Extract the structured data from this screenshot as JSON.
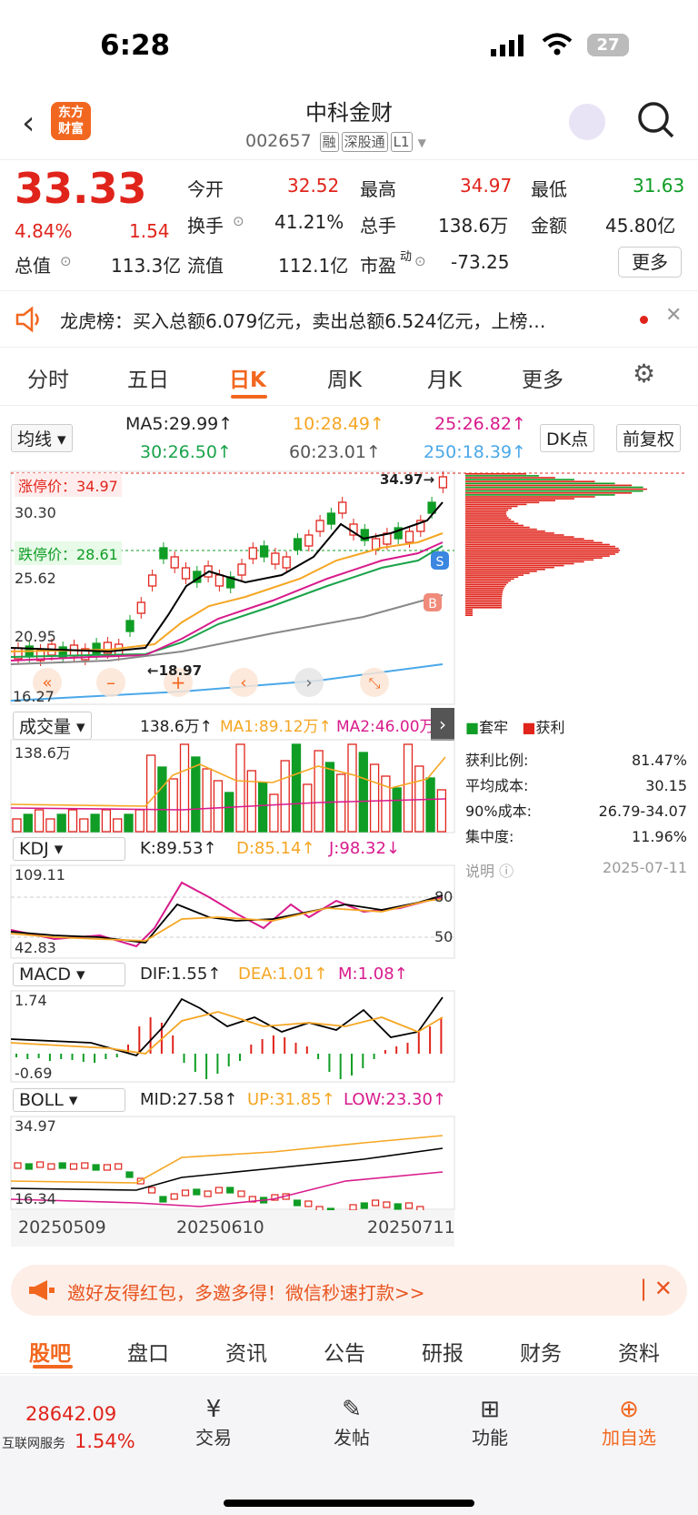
{
  "status": {
    "time": "6:28",
    "battery": "27"
  },
  "header": {
    "title": "中科金财",
    "code": "002657",
    "tags": [
      "融",
      "深股通",
      "L1"
    ],
    "logo": "东方\n财富"
  },
  "quote": {
    "price": "33.33",
    "pct": "4.84%",
    "chg": "1.54",
    "open_label": "今开",
    "open": "32.52",
    "high_label": "最高",
    "high": "34.97",
    "low_label": "最低",
    "low": "31.63",
    "turn_label": "换手",
    "turn": "41.21%",
    "vol_label": "总手",
    "vol": "138.6万",
    "amt_label": "金额",
    "amt": "45.80亿",
    "mcap_label": "总值",
    "mcap": "113.3亿",
    "float_label": "流值",
    "float": "112.1亿",
    "pe_label": "市盈",
    "pe_sup": "动",
    "pe": "-73.25",
    "more": "更多"
  },
  "notice": {
    "text": "龙虎榜：买入总额6.079亿元，卖出总额6.524亿元，上榜…"
  },
  "tabs": [
    "分时",
    "五日",
    "日K",
    "周K",
    "月K",
    "更多",
    "⚙"
  ],
  "ma": {
    "select": "均线",
    "ma5": "MA5:29.99↑",
    "ma10": "10:28.49↑",
    "ma25": "25:26.82↑",
    "ma30": "30:26.50↑",
    "ma60": "60:23.01↑",
    "ma250": "250:18.39↑",
    "dk": "DK点",
    "fq": "前复权"
  },
  "kline": {
    "top": "34.97",
    "p1": "30.30",
    "p2": "25.62",
    "p3": "20.95",
    "bottom": "16.27",
    "limit_up": "涨停价：34.97",
    "limit_down": "跌停价：28.61",
    "hi_mark": "34.97→",
    "lo_mark": "←18.97",
    "S": "S",
    "B": "B"
  },
  "chip": {
    "legend1": "套牢",
    "legend2": "获利",
    "profit_ratio_l": "获利比例:",
    "profit_ratio": "81.47%",
    "avg_cost_l": "平均成本:",
    "avg_cost": "30.15",
    "c90_l": "90%成本:",
    "c90": "26.79-34.07",
    "conc_l": "集中度:",
    "conc": "11.96%",
    "note": "说明",
    "date": "2025-07-11"
  },
  "vol": {
    "select": "成交量",
    "v": "138.6万↑",
    "ma1": "MA1:89.12万↑",
    "ma2": "MA2:46.00万↑",
    "axis": "138.6万"
  },
  "kdj": {
    "select": "KDJ",
    "k": "K:89.53↑",
    "d": "D:85.14↑",
    "j": "J:98.32↓",
    "top": "109.11",
    "bottom": "42.83",
    "l80": "80",
    "l50": "50"
  },
  "macd": {
    "select": "MACD",
    "dif": "DIF:1.55↑",
    "dea": "DEA:1.01↑",
    "m": "M:1.08↑",
    "top": "1.74",
    "bottom": "-0.69"
  },
  "boll": {
    "select": "BOLL",
    "mid": "MID:27.58↑",
    "up": "UP:31.85↑",
    "low": "LOW:23.30↑",
    "top": "34.97",
    "bottom": "16.34"
  },
  "dates": [
    "20250509",
    "20250610",
    "20250711"
  ],
  "banner": "邀好友得红包，多邀多得！微信秒速打款>>",
  "nav": [
    "股吧",
    "盘口",
    "资讯",
    "公告",
    "研报",
    "财务",
    "资料"
  ],
  "bottom": {
    "index": "28642.09",
    "index_label": "互联网服务",
    "index_pct": "1.54%",
    "trade": "交易",
    "post": "发帖",
    "func": "功能",
    "add": "加自选"
  },
  "colors": {
    "up": "#e0241b",
    "down": "#0f9d25",
    "accent": "#f2671f"
  }
}
